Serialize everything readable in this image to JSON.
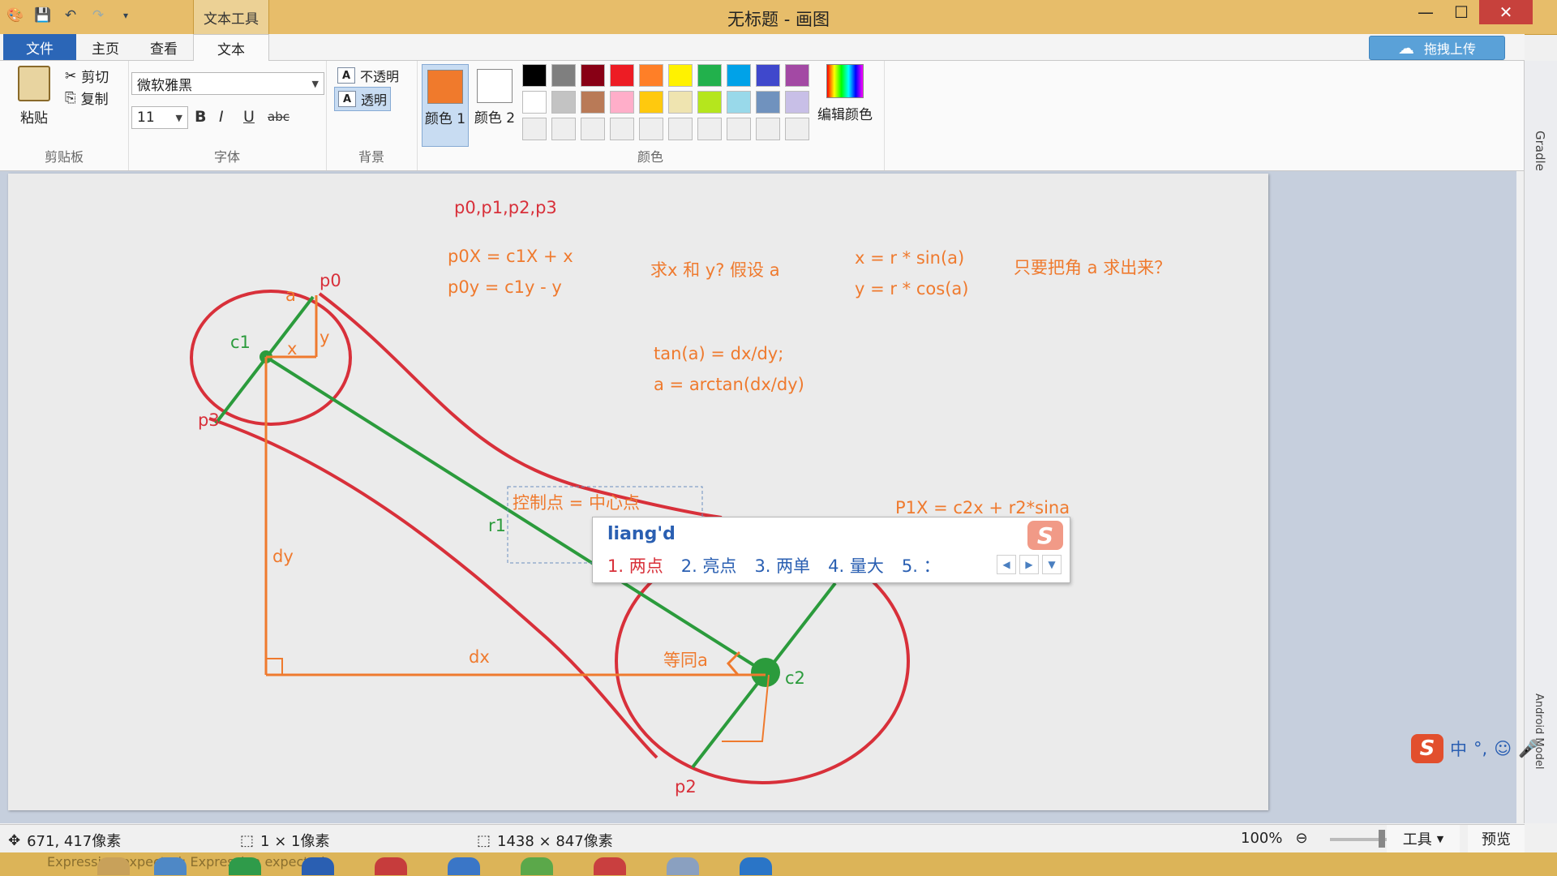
{
  "app": {
    "window_title": "无标题 - 画图",
    "context_tab": "文本工具",
    "window_controls": {
      "minimize": "—",
      "maximize": "☐",
      "close": "✕"
    }
  },
  "tabs": [
    {
      "label": "文件"
    },
    {
      "label": "主页"
    },
    {
      "label": "查看"
    },
    {
      "label": "文本"
    }
  ],
  "upload_button": "拖拽上传",
  "ribbon": {
    "clipboard": {
      "paste": "粘贴",
      "cut": "剪切",
      "copy": "复制",
      "group": "剪贴板"
    },
    "font": {
      "family": "微软雅黑",
      "size": "11",
      "bold": "B",
      "italic": "I",
      "underline": "U",
      "strike": "abc",
      "group": "字体"
    },
    "background": {
      "opaque": "不透明",
      "transparent": "透明",
      "group": "背景"
    },
    "colors": {
      "color1_label": "颜色 1",
      "color2_label": "颜色 2",
      "color1": "#f07a2c",
      "color2": "#ffffff",
      "edit_label": "编辑颜色",
      "group": "颜色",
      "palette": [
        "#000000",
        "#7f7f7f",
        "#880015",
        "#ed1c24",
        "#ff7f27",
        "#fff200",
        "#22b14c",
        "#00a2e8",
        "#3f48cc",
        "#a349a4",
        "#ffffff",
        "#c3c3c3",
        "#b97a57",
        "#ffaec9",
        "#ffc90e",
        "#efe4b0",
        "#b5e61d",
        "#99d9ea",
        "#7092be",
        "#c8bfe7",
        "#eeeeee",
        "#eeeeee",
        "#eeeeee",
        "#eeeeee",
        "#eeeeee",
        "#eeeeee",
        "#eeeeee",
        "#eeeeee",
        "#eeeeee",
        "#eeeeee"
      ]
    }
  },
  "canvas_text": {
    "points": "p0,p1,p2,p3",
    "p0x": "p0X = c1X + x",
    "p0y": "p0y =  c1y - y",
    "question": "求x 和 y? 假设 a",
    "xr": "x = r * sin(a)",
    "yr": "y = r * cos(a)",
    "angle_note": "只要把角 a 求出来？",
    "tan": "tan(a) = dx/dy;",
    "arctan": "a = arctan(dx/dy)",
    "textbox": "控制点 = 中心点",
    "p1x": "P1X = c2x + r2*sina",
    "label_a": "a",
    "label_p0": "p0",
    "label_c1": "c1",
    "label_x": "x",
    "label_y": "y",
    "label_p3": "p3",
    "label_r1": "r1",
    "label_dy": "dy",
    "label_dx": "dx",
    "label_same_a": "等同a",
    "label_c2": "c2",
    "label_p2": "p2"
  },
  "ime": {
    "composition": "liang'd",
    "candidates": [
      "1. 两点",
      "2. 亮点",
      "3. 两单",
      "4. 量大",
      "5. ："
    ],
    "logo": "S"
  },
  "ime_tray": {
    "mode": "中",
    "punct": "°,",
    "logo": "S"
  },
  "side_labels": {
    "top": "Gradle",
    "bottom": "Android Model"
  },
  "status": {
    "cursor": "671, 417像素",
    "selection": "1 × 1像素",
    "image_size": "1438 × 847像素",
    "zoom": "100%",
    "tools": "工具",
    "preview": "预览"
  },
  "taskbar": {
    "message": "Expression expected: Expression expected"
  }
}
